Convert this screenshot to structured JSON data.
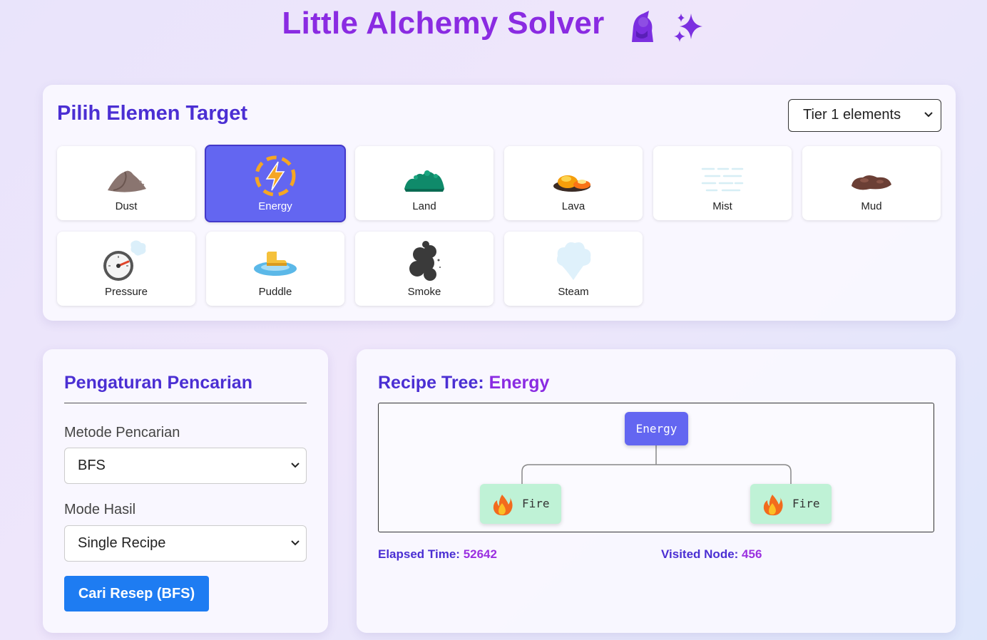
{
  "app": {
    "title": "Little Alchemy Solver",
    "title_icons": [
      "mage-icon",
      "sparkles-icon"
    ]
  },
  "target": {
    "heading": "Pilih Elemen Target",
    "tier_select": {
      "value": "Tier 1 elements"
    },
    "selected": "Energy",
    "elements": [
      {
        "label": "Dust",
        "icon": "dust-icon"
      },
      {
        "label": "Energy",
        "icon": "energy-icon"
      },
      {
        "label": "Land",
        "icon": "land-icon"
      },
      {
        "label": "Lava",
        "icon": "lava-icon"
      },
      {
        "label": "Mist",
        "icon": "mist-icon"
      },
      {
        "label": "Mud",
        "icon": "mud-icon"
      },
      {
        "label": "Pressure",
        "icon": "pressure-gauge-icon"
      },
      {
        "label": "Puddle",
        "icon": "puddle-icon"
      },
      {
        "label": "Smoke",
        "icon": "smoke-icon"
      },
      {
        "label": "Steam",
        "icon": "steam-icon"
      }
    ]
  },
  "settings": {
    "heading": "Pengaturan Pencarian",
    "method_label": "Metode Pencarian",
    "method_value": "BFS",
    "mode_label": "Mode Hasil",
    "mode_value": "Single Recipe",
    "search_button": "Cari Resep (BFS)"
  },
  "tree": {
    "heading_prefix": "Recipe Tree: ",
    "heading_target": "Energy",
    "root": "Energy",
    "children": [
      {
        "label": "Fire",
        "icon": "fire-icon"
      },
      {
        "label": "Fire",
        "icon": "fire-icon"
      }
    ],
    "elapsed_label": "Elapsed Time: ",
    "elapsed_value": "52642",
    "visited_label": "Visited Node: ",
    "visited_value": "456"
  },
  "colors": {
    "accent_purple": "#8a2be2",
    "heading_indigo": "#4b2fd3",
    "selected_tile": "#6366f1",
    "button_blue": "#1e7cf2",
    "leaf_green": "#bff2d6"
  }
}
